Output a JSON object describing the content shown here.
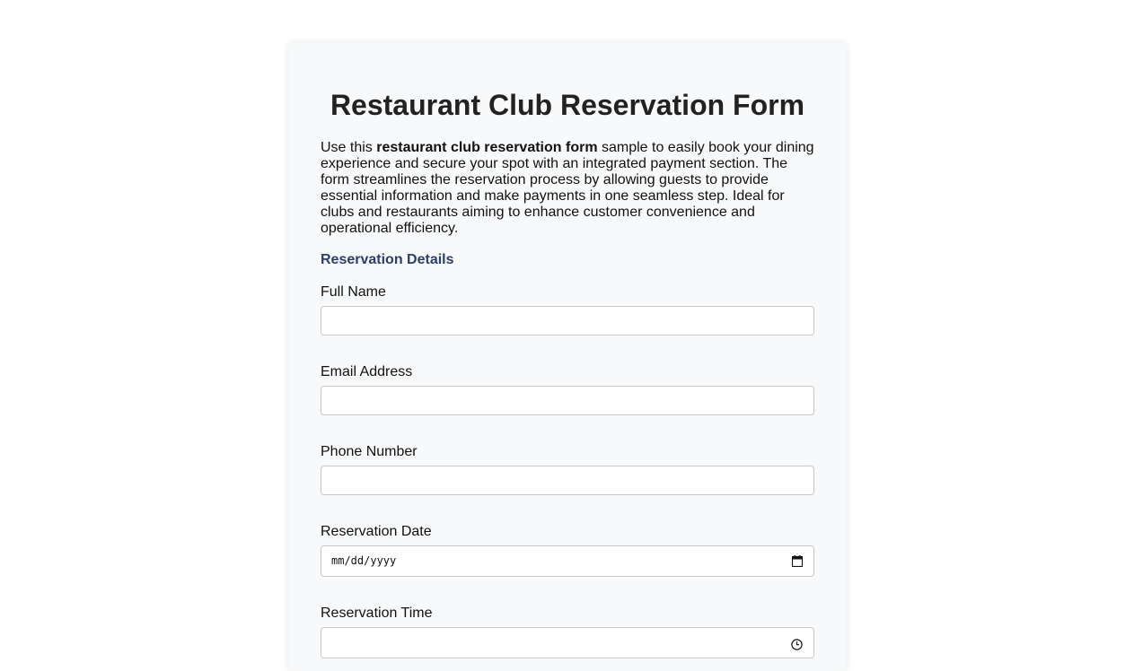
{
  "form": {
    "title": "Restaurant Club Reservation Form",
    "intro": {
      "before": "Use this ",
      "bold": "restaurant club reservation form",
      "after": " sample to easily book your dining experience and secure your spot with an integrated payment section. The form streamlines the reservation process by allowing guests to provide essential information and make payments in one seamless step. Ideal for clubs and restaurants aiming to enhance customer convenience and operational efficiency."
    },
    "section_heading": "Reservation Details",
    "section_heading_color": "#2c3e6b",
    "fields": {
      "full_name": {
        "label": "Full Name",
        "value": ""
      },
      "email": {
        "label": "Email Address",
        "value": ""
      },
      "phone": {
        "label": "Phone Number",
        "value": ""
      },
      "date": {
        "label": "Reservation Date",
        "placeholder": "mm/dd/yyyy",
        "icon": "calendar-icon"
      },
      "time": {
        "label": "Reservation Time",
        "icon": "clock-icon"
      }
    }
  }
}
